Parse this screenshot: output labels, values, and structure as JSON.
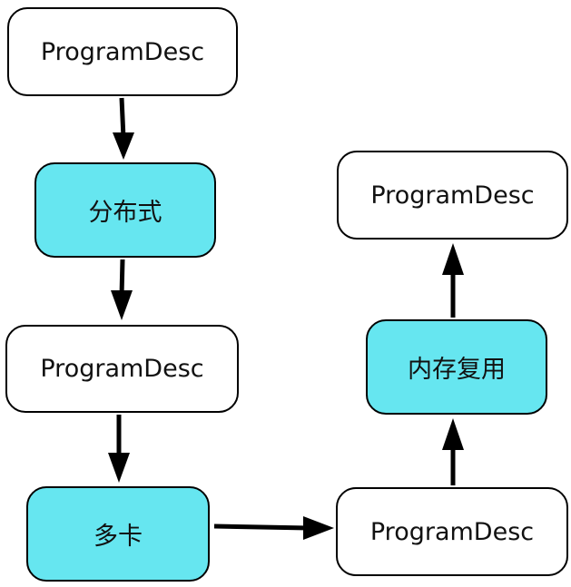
{
  "colors": {
    "node_fill": "#ffffff",
    "highlight_fill": "#66e6f0",
    "stroke": "#000000",
    "text": "#111111"
  },
  "nodes": [
    {
      "label": "ProgramDesc",
      "style": "plain"
    },
    {
      "label": "分布式",
      "style": "highlight"
    },
    {
      "label": "ProgramDesc",
      "style": "plain"
    },
    {
      "label": "多卡",
      "style": "highlight"
    },
    {
      "label": "ProgramDesc",
      "style": "plain"
    },
    {
      "label": "内存复用",
      "style": "highlight"
    },
    {
      "label": "ProgramDesc",
      "style": "plain"
    }
  ],
  "edges": [
    {
      "from": 0,
      "to": 1
    },
    {
      "from": 1,
      "to": 2
    },
    {
      "from": 2,
      "to": 3
    },
    {
      "from": 3,
      "to": 4
    },
    {
      "from": 4,
      "to": 5
    },
    {
      "from": 5,
      "to": 6
    }
  ]
}
